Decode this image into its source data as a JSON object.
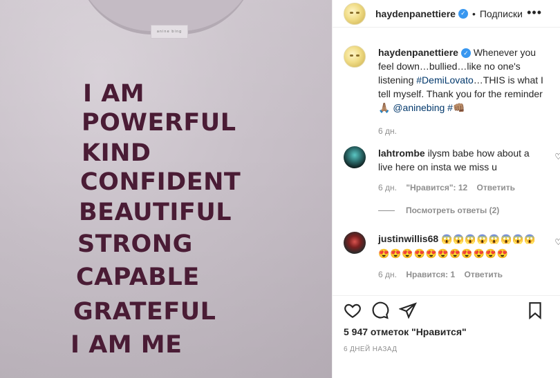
{
  "post": {
    "username": "haydenpanettiere",
    "follow_label": "Подписки",
    "more": "•••"
  },
  "photo": {
    "tag_text": "anine bing",
    "lines": [
      "I AM",
      "POWERFUL",
      "KIND",
      "CONFIDENT",
      "BEAUTIFUL",
      "STRONG",
      "CAPABLE",
      "GRATEFUL",
      "I AM ME"
    ]
  },
  "caption": {
    "username": "haydenpanettiere",
    "text_1": "Whenever you feel down…bullied…like no one's listening",
    "mention_1": "#DemiLovato",
    "text_2": "…THIS is what I tell myself. Thank you for the reminder🙏🏽",
    "mention_2": "@aninebing",
    "mention_3": "#👊🏽",
    "time": "6 дн."
  },
  "comments": [
    {
      "username": "lahtrombe",
      "text": "ilysm babe how about a live here on insta we miss u",
      "time": "6 дн.",
      "likes": "\"Нравится\": 12",
      "reply": "Ответить"
    },
    {
      "username": "justinwillis68",
      "text": "😱😱😱😱😱😱😱😱😍😍😍😍😍😍😍😍😍😍😍",
      "time": "6 дн.",
      "likes": "Нравится: 1",
      "reply": "Ответить"
    }
  ],
  "replies_label": "Посмотреть ответы (2)",
  "footer": {
    "likes": "5 947 отметок \"Нравится\"",
    "time": "6 ДНЕЙ НАЗАД"
  }
}
